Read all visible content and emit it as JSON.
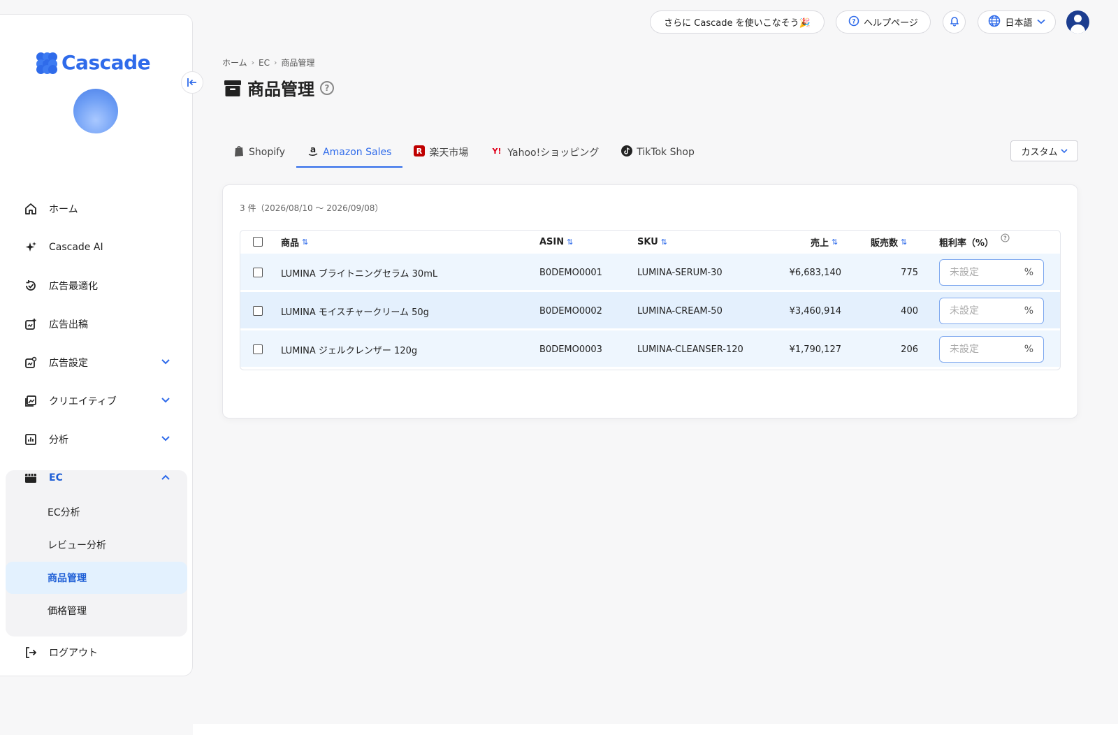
{
  "app": {
    "logo_text": "Cascade"
  },
  "topbar": {
    "promo_label": "さらに Cascade を使いこなそう🎉",
    "help_label": "ヘルプページ",
    "language_label": "日本語"
  },
  "sidebar": {
    "items": [
      {
        "label": "ホーム",
        "icon": "home-icon"
      },
      {
        "label": "Cascade AI",
        "icon": "sparkle-icon"
      },
      {
        "label": "広告最適化",
        "icon": "optimize-icon"
      },
      {
        "label": "広告出稿",
        "icon": "ad-publish-icon"
      },
      {
        "label": "広告設定",
        "icon": "ad-settings-icon"
      },
      {
        "label": "クリエイティブ",
        "icon": "image-icon"
      },
      {
        "label": "分析",
        "icon": "chart-icon"
      },
      {
        "label": "EC",
        "icon": "store-icon"
      }
    ],
    "ec_sub": [
      "EC分析",
      "レビュー分析",
      "商品管理",
      "価格管理"
    ],
    "logout_label": "ログアウト"
  },
  "breadcrumb": [
    "ホーム",
    "EC",
    "商品管理"
  ],
  "page": {
    "title": "商品管理",
    "help": "?"
  },
  "tabs": [
    {
      "label": "Shopify",
      "active": false
    },
    {
      "label": "Amazon Sales",
      "active": true
    },
    {
      "label": "楽天市場",
      "active": false
    },
    {
      "label": "Yahoo!ショッピング",
      "active": false
    },
    {
      "label": "TikTok Shop",
      "active": false
    }
  ],
  "custom_label": "カスタム",
  "table": {
    "count_text": "3 件（2026/08/10 〜 2026/09/08）",
    "headers": {
      "product": "商品",
      "asin": "ASIN",
      "sku": "SKU",
      "sales": "売上",
      "units": "販売数",
      "margin": "粗利率（%）"
    },
    "rows": [
      {
        "product": "LUMINA ブライトニングセラム 30mL",
        "asin": "B0DEMO0001",
        "sku": "LUMINA-SERUM-30",
        "sales": "¥6,683,140",
        "units": "775",
        "margin_placeholder": "未設定",
        "unit": "%"
      },
      {
        "product": "LUMINA モイスチャークリーム 50g",
        "asin": "B0DEMO0002",
        "sku": "LUMINA-CREAM-50",
        "sales": "¥3,460,914",
        "units": "400",
        "margin_placeholder": "未設定",
        "unit": "%"
      },
      {
        "product": "LUMINA ジェルクレンザー 120g",
        "asin": "B0DEMO0003",
        "sku": "LUMINA-CLEANSER-120",
        "sales": "¥1,790,127",
        "units": "206",
        "margin_placeholder": "未設定",
        "unit": "%"
      }
    ]
  },
  "colors": {
    "accent": "#2f6bea",
    "row_bg": "#eef6fe",
    "active_bg": "#e3f1fe"
  }
}
